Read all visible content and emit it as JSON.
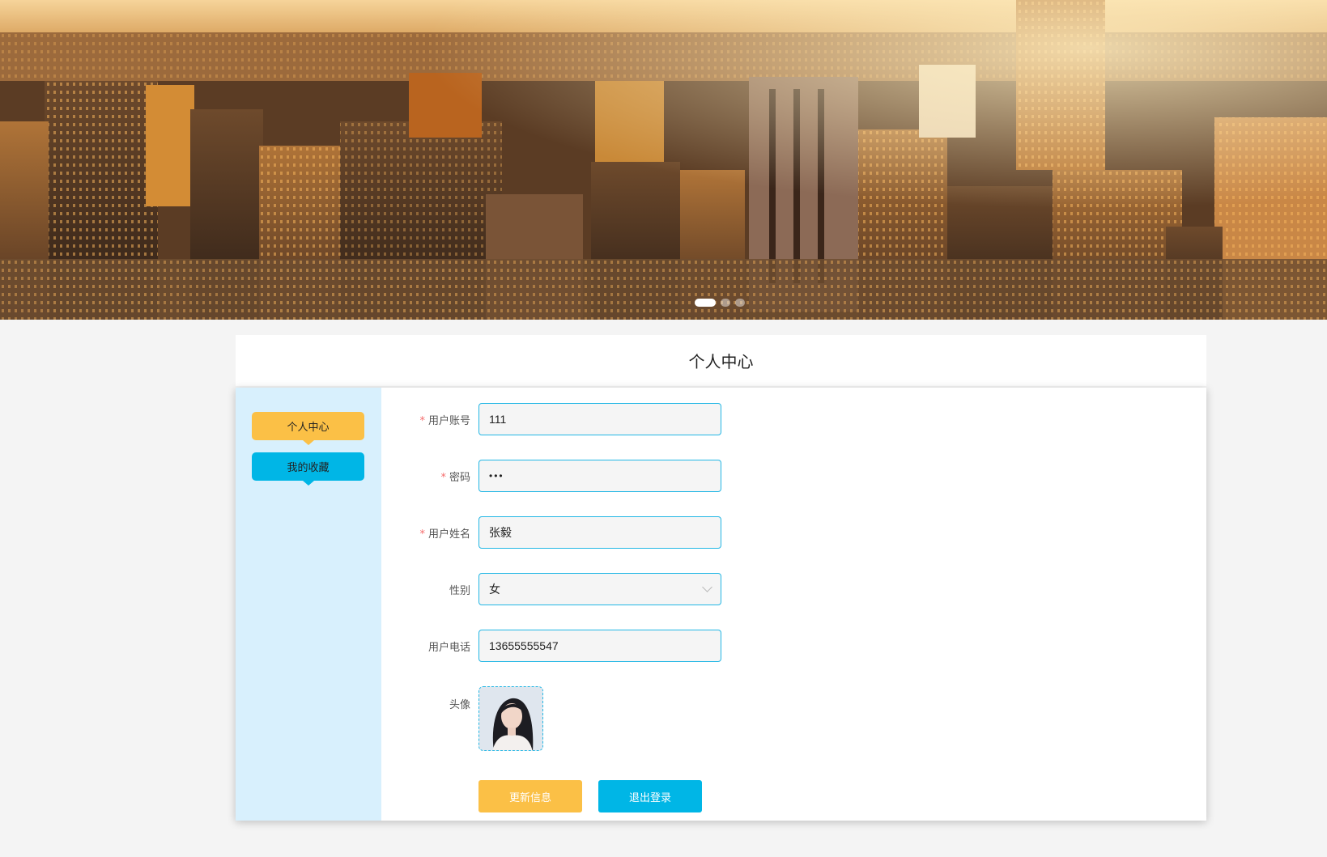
{
  "banner": {
    "dots": 3,
    "active_dot": 1
  },
  "page_title": "个人中心",
  "sidebar": {
    "items": [
      {
        "label": "个人中心",
        "color": "#fbc046"
      },
      {
        "label": "我的收藏",
        "color": "#00b6e6"
      }
    ]
  },
  "form": {
    "account": {
      "label": "用户账号",
      "value": "111",
      "required": true
    },
    "password": {
      "label": "密码",
      "value": "•••",
      "required": true
    },
    "name": {
      "label": "用户姓名",
      "value": "张毅",
      "required": true
    },
    "gender": {
      "label": "性别",
      "value": "女"
    },
    "phone": {
      "label": "用户电话",
      "value": "13655555547"
    },
    "avatar": {
      "label": "头像"
    }
  },
  "actions": {
    "update_label": "更新信息",
    "logout_label": "退出登录"
  },
  "colors": {
    "accent_yellow": "#fbc046",
    "accent_blue": "#00b6e6",
    "sidebar_bg": "#d8f0fd",
    "required_mark": "#f56c6c"
  }
}
